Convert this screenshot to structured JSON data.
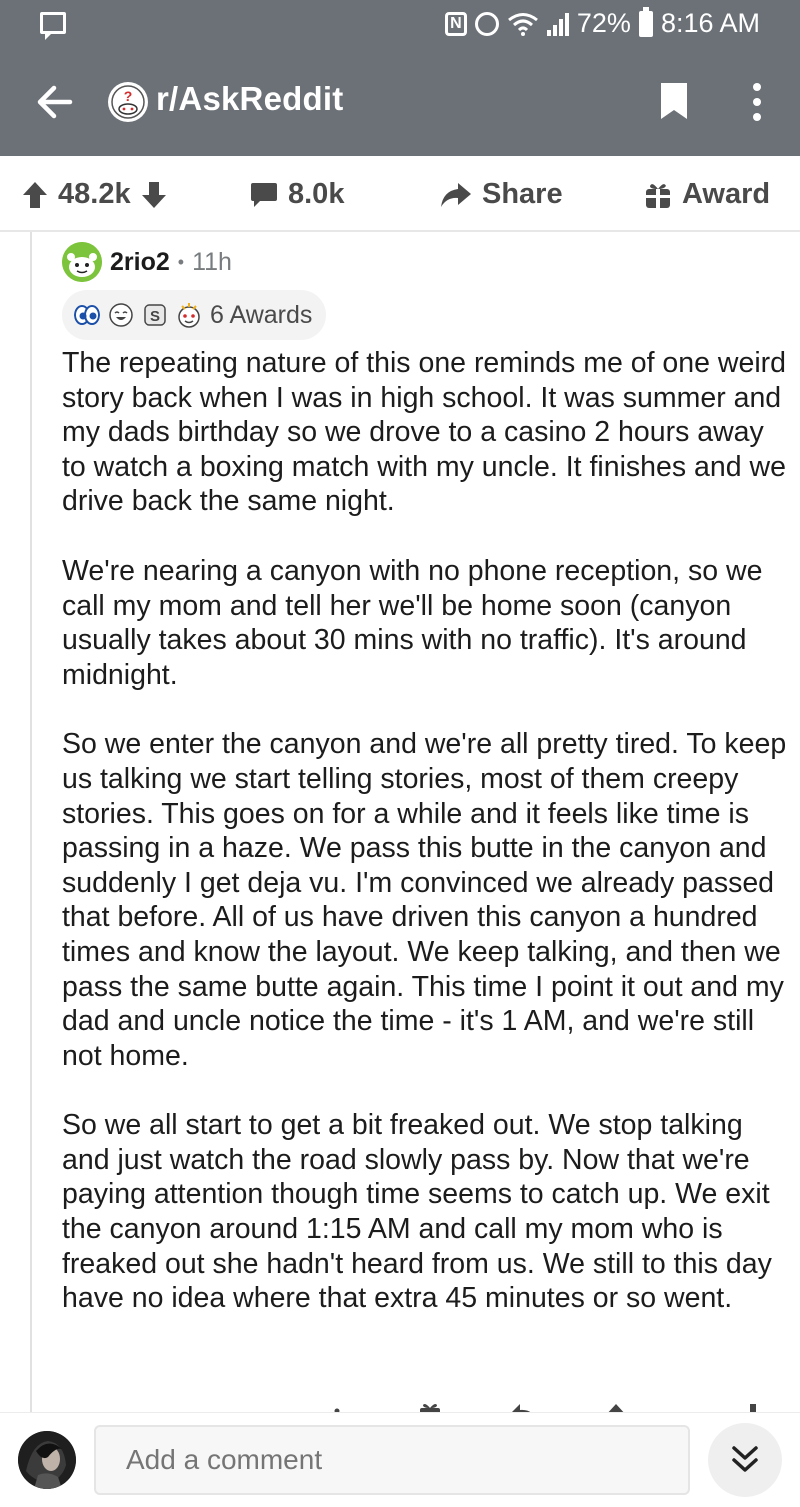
{
  "status_bar": {
    "nfc": "N",
    "battery": "72%",
    "time": "8:16 AM"
  },
  "header": {
    "subreddit": "r/AskReddit"
  },
  "post_actions": {
    "upvotes": "48.2k",
    "comments": "8.0k",
    "share_label": "Share",
    "award_label": "Award"
  },
  "comment": {
    "author": "2rio2",
    "separator": "•",
    "age": "11h",
    "awards_label": "6 Awards",
    "paragraphs": [
      "The repeating nature of this one reminds me of one weird story back when I was in high school. It was summer and my dads birthday so we drove to a casino 2 hours away to watch a boxing match with my uncle. It finishes and we drive back the same night.",
      "We're nearing a canyon with no phone reception, so we call my mom and tell her we'll be home soon (canyon usually takes about 30 mins with no traffic). It's around midnight.",
      "So we enter the canyon and we're all pretty tired. To keep us talking we start telling stories, most of them creepy stories. This goes on for a while and it feels like time is passing in a haze. We pass this butte in the canyon and suddenly I get deja vu. I'm convinced we already passed that before. All of us have driven this canyon a hundred times and know the layout. We keep talking, and then we pass the same butte again. This time I point it out and my dad and uncle notice the time - it's 1 AM, and we're still not home.",
      "So we all start to get a bit freaked out. We stop talking and just watch the road slowly pass by. Now that we're paying attention though time seems to catch up. We exit the canyon around 1:15 AM and call my mom who is freaked out she hadn't heard from us. We still to this day have no idea where that extra 45 minutes or so went."
    ]
  },
  "composer": {
    "placeholder": "Add a comment"
  },
  "colors": {
    "header_bg": "#6b7177",
    "text": "#1c1c1c",
    "muted": "#787c7e"
  }
}
